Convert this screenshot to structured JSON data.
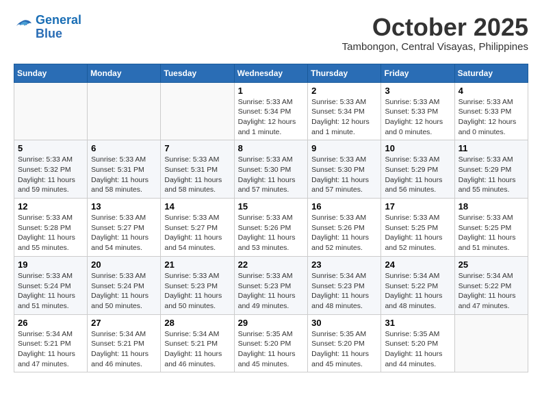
{
  "header": {
    "logo_line1": "General",
    "logo_line2": "Blue",
    "month": "October 2025",
    "location": "Tambongon, Central Visayas, Philippines"
  },
  "weekdays": [
    "Sunday",
    "Monday",
    "Tuesday",
    "Wednesday",
    "Thursday",
    "Friday",
    "Saturday"
  ],
  "weeks": [
    [
      {
        "day": "",
        "info": ""
      },
      {
        "day": "",
        "info": ""
      },
      {
        "day": "",
        "info": ""
      },
      {
        "day": "1",
        "info": "Sunrise: 5:33 AM\nSunset: 5:34 PM\nDaylight: 12 hours\nand 1 minute."
      },
      {
        "day": "2",
        "info": "Sunrise: 5:33 AM\nSunset: 5:34 PM\nDaylight: 12 hours\nand 1 minute."
      },
      {
        "day": "3",
        "info": "Sunrise: 5:33 AM\nSunset: 5:33 PM\nDaylight: 12 hours\nand 0 minutes."
      },
      {
        "day": "4",
        "info": "Sunrise: 5:33 AM\nSunset: 5:33 PM\nDaylight: 12 hours\nand 0 minutes."
      }
    ],
    [
      {
        "day": "5",
        "info": "Sunrise: 5:33 AM\nSunset: 5:32 PM\nDaylight: 11 hours\nand 59 minutes."
      },
      {
        "day": "6",
        "info": "Sunrise: 5:33 AM\nSunset: 5:31 PM\nDaylight: 11 hours\nand 58 minutes."
      },
      {
        "day": "7",
        "info": "Sunrise: 5:33 AM\nSunset: 5:31 PM\nDaylight: 11 hours\nand 58 minutes."
      },
      {
        "day": "8",
        "info": "Sunrise: 5:33 AM\nSunset: 5:30 PM\nDaylight: 11 hours\nand 57 minutes."
      },
      {
        "day": "9",
        "info": "Sunrise: 5:33 AM\nSunset: 5:30 PM\nDaylight: 11 hours\nand 57 minutes."
      },
      {
        "day": "10",
        "info": "Sunrise: 5:33 AM\nSunset: 5:29 PM\nDaylight: 11 hours\nand 56 minutes."
      },
      {
        "day": "11",
        "info": "Sunrise: 5:33 AM\nSunset: 5:29 PM\nDaylight: 11 hours\nand 55 minutes."
      }
    ],
    [
      {
        "day": "12",
        "info": "Sunrise: 5:33 AM\nSunset: 5:28 PM\nDaylight: 11 hours\nand 55 minutes."
      },
      {
        "day": "13",
        "info": "Sunrise: 5:33 AM\nSunset: 5:27 PM\nDaylight: 11 hours\nand 54 minutes."
      },
      {
        "day": "14",
        "info": "Sunrise: 5:33 AM\nSunset: 5:27 PM\nDaylight: 11 hours\nand 54 minutes."
      },
      {
        "day": "15",
        "info": "Sunrise: 5:33 AM\nSunset: 5:26 PM\nDaylight: 11 hours\nand 53 minutes."
      },
      {
        "day": "16",
        "info": "Sunrise: 5:33 AM\nSunset: 5:26 PM\nDaylight: 11 hours\nand 52 minutes."
      },
      {
        "day": "17",
        "info": "Sunrise: 5:33 AM\nSunset: 5:25 PM\nDaylight: 11 hours\nand 52 minutes."
      },
      {
        "day": "18",
        "info": "Sunrise: 5:33 AM\nSunset: 5:25 PM\nDaylight: 11 hours\nand 51 minutes."
      }
    ],
    [
      {
        "day": "19",
        "info": "Sunrise: 5:33 AM\nSunset: 5:24 PM\nDaylight: 11 hours\nand 51 minutes."
      },
      {
        "day": "20",
        "info": "Sunrise: 5:33 AM\nSunset: 5:24 PM\nDaylight: 11 hours\nand 50 minutes."
      },
      {
        "day": "21",
        "info": "Sunrise: 5:33 AM\nSunset: 5:23 PM\nDaylight: 11 hours\nand 50 minutes."
      },
      {
        "day": "22",
        "info": "Sunrise: 5:33 AM\nSunset: 5:23 PM\nDaylight: 11 hours\nand 49 minutes."
      },
      {
        "day": "23",
        "info": "Sunrise: 5:34 AM\nSunset: 5:23 PM\nDaylight: 11 hours\nand 48 minutes."
      },
      {
        "day": "24",
        "info": "Sunrise: 5:34 AM\nSunset: 5:22 PM\nDaylight: 11 hours\nand 48 minutes."
      },
      {
        "day": "25",
        "info": "Sunrise: 5:34 AM\nSunset: 5:22 PM\nDaylight: 11 hours\nand 47 minutes."
      }
    ],
    [
      {
        "day": "26",
        "info": "Sunrise: 5:34 AM\nSunset: 5:21 PM\nDaylight: 11 hours\nand 47 minutes."
      },
      {
        "day": "27",
        "info": "Sunrise: 5:34 AM\nSunset: 5:21 PM\nDaylight: 11 hours\nand 46 minutes."
      },
      {
        "day": "28",
        "info": "Sunrise: 5:34 AM\nSunset: 5:21 PM\nDaylight: 11 hours\nand 46 minutes."
      },
      {
        "day": "29",
        "info": "Sunrise: 5:35 AM\nSunset: 5:20 PM\nDaylight: 11 hours\nand 45 minutes."
      },
      {
        "day": "30",
        "info": "Sunrise: 5:35 AM\nSunset: 5:20 PM\nDaylight: 11 hours\nand 45 minutes."
      },
      {
        "day": "31",
        "info": "Sunrise: 5:35 AM\nSunset: 5:20 PM\nDaylight: 11 hours\nand 44 minutes."
      },
      {
        "day": "",
        "info": ""
      }
    ]
  ]
}
